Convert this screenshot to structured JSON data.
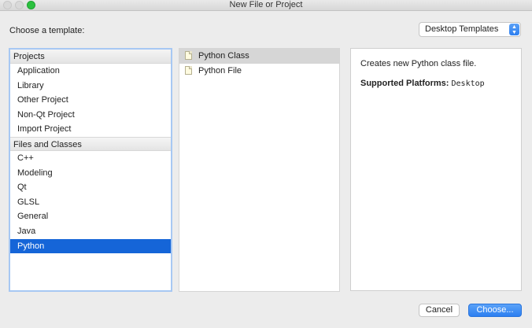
{
  "window": {
    "title": "New File or Project"
  },
  "header": {
    "choose_label": "Choose a template:",
    "filter_value": "Desktop Templates"
  },
  "categories": {
    "groups": [
      {
        "label": "Projects",
        "items": [
          "Application",
          "Library",
          "Other Project",
          "Non-Qt Project",
          "Import Project"
        ]
      },
      {
        "label": "Files and Classes",
        "items": [
          "C++",
          "Modeling",
          "Qt",
          "GLSL",
          "General",
          "Java",
          "Python"
        ]
      }
    ],
    "selected": "Python"
  },
  "templates": {
    "items": [
      "Python Class",
      "Python File"
    ],
    "selected": "Python Class",
    "icon": "python-file-icon"
  },
  "description": {
    "text": "Creates new Python class file.",
    "platforms_label": "Supported Platforms:",
    "platforms_value": "Desktop"
  },
  "footer": {
    "cancel_label": "Cancel",
    "choose_label": "Choose..."
  },
  "colors": {
    "selection": "#1565d8",
    "accent": "#2c7ff1",
    "focus_border": "#a7c8f3"
  }
}
